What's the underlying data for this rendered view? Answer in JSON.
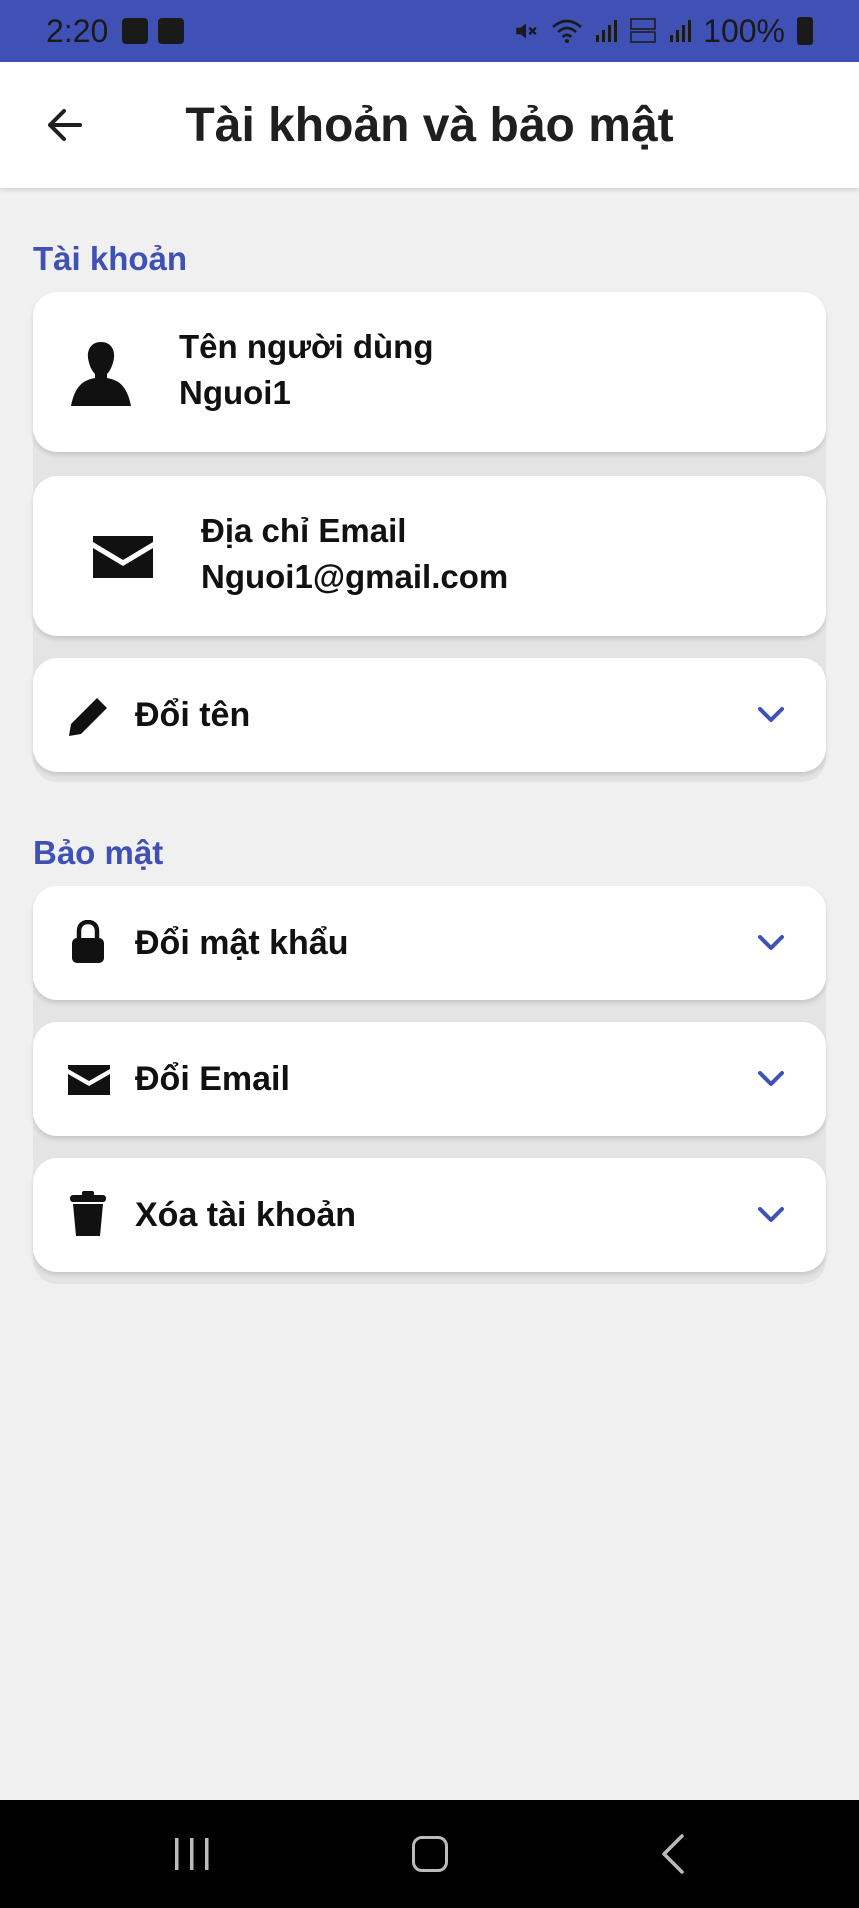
{
  "status_bar": {
    "time": "2:20",
    "battery": "100%",
    "icons": [
      "gallery-icon",
      "contact-icon",
      "mute-icon",
      "wifi-icon",
      "signal-icon",
      "volte-icon",
      "signal-icon",
      "battery-icon"
    ]
  },
  "app_bar": {
    "title": "Tài khoản và bảo mật",
    "back_icon": "arrow-left-icon"
  },
  "account_section": {
    "title": "Tài khoản",
    "username": {
      "label": "Tên người dùng",
      "value": "Nguoi1",
      "icon": "person-icon"
    },
    "email": {
      "label": "Địa chỉ Email",
      "value": "Nguoi1@gmail.com",
      "icon": "mail-icon"
    },
    "rename": {
      "label": "Đổi tên",
      "icon": "pencil-icon"
    }
  },
  "security_section": {
    "title": "Bảo mật",
    "items": [
      {
        "label": "Đổi mật khẩu",
        "icon": "lock-icon"
      },
      {
        "label": "Đổi Email",
        "icon": "mail-icon"
      },
      {
        "label": "Xóa tài khoản",
        "icon": "trash-icon"
      }
    ]
  },
  "colors": {
    "accent": "#3f51b5",
    "background": "#f0f0f0",
    "card": "#ffffff"
  }
}
